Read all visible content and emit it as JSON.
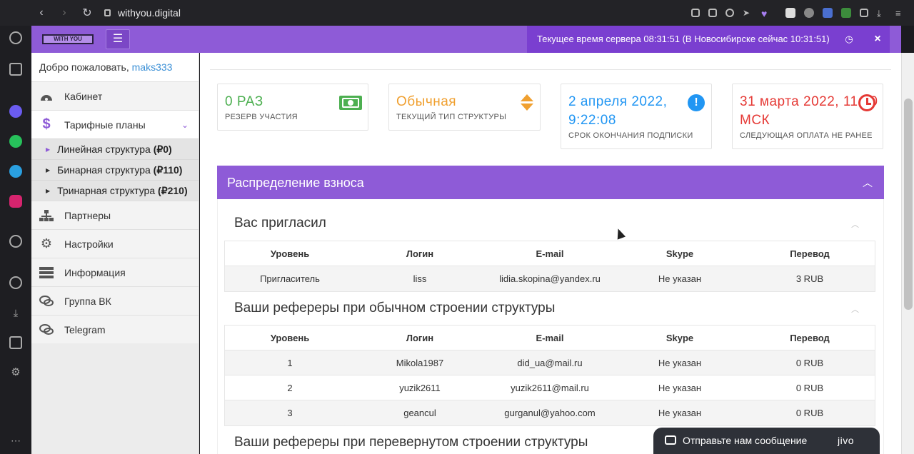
{
  "browser": {
    "url": "withyou.digital"
  },
  "topbar": {
    "logo_text": "WITH YOU",
    "server_time": "Текущее время сервера 08:31:51 (В Новосибирске сейчас 10:31:51)"
  },
  "sidebar": {
    "welcome_prefix": "Добро пожаловать,",
    "username": "maks333",
    "items": [
      {
        "label": "Кабинет"
      },
      {
        "label": "Тарифные планы"
      },
      {
        "label": "Партнеры"
      },
      {
        "label": "Настройки"
      },
      {
        "label": "Информация"
      },
      {
        "label": "Группа ВК"
      },
      {
        "label": "Telegram"
      }
    ],
    "subitems": [
      {
        "label": "Линейная структура ",
        "price": "(₽0)"
      },
      {
        "label": "Бинарная структура ",
        "price": "(₽110)"
      },
      {
        "label": "Тринарная структура ",
        "price": "(₽210)"
      }
    ]
  },
  "cards": [
    {
      "value": "0 РАЗ",
      "label": "РЕЗЕРВ УЧАСТИЯ",
      "color": "#4caf50"
    },
    {
      "value": "Обычная",
      "label": "ТЕКУЩИЙ ТИП СТРУКТУРЫ",
      "color": "#f0a030"
    },
    {
      "value_line1": "2 апреля 2022,",
      "value_line2": "9:22:08",
      "label": "СРОК ОКОНЧАНИЯ ПОДПИСКИ",
      "color": "#2196f3"
    },
    {
      "value_line1": "31 марта 2022, 11:00",
      "value_line2": "МСК",
      "label": "СЛЕДУЮЩАЯ ОПЛАТА НЕ РАНЕЕ",
      "color": "#e53935"
    }
  ],
  "panel": {
    "title": "Распределение взноса"
  },
  "sections": [
    {
      "title": "Вас пригласил",
      "headers": [
        "Уровень",
        "Логин",
        "E-mail",
        "Skype",
        "Перевод"
      ],
      "rows": [
        [
          "Пригласитель",
          "liss",
          "lidia.skopina@yandex.ru",
          "Не указан",
          "3 RUB"
        ]
      ]
    },
    {
      "title": "Ваши рефереры при обычном строении структуры",
      "headers": [
        "Уровень",
        "Логин",
        "E-mail",
        "Skype",
        "Перевод"
      ],
      "rows": [
        [
          "1",
          "Mikola1987",
          "did_ua@mail.ru",
          "Не указан",
          "0 RUB"
        ],
        [
          "2",
          "yuzik2611",
          "yuzik2611@mail.ru",
          "Не указан",
          "0 RUB"
        ],
        [
          "3",
          "geancul",
          "gurganul@yahoo.com",
          "Не указан",
          "0 RUB"
        ]
      ]
    },
    {
      "title": "Ваши рефереры при перевернутом строении структуры"
    }
  ],
  "chat": {
    "text": "Отправьте нам сообщение",
    "brand": "jivo"
  },
  "colors": {
    "accent": "#8e5bd7",
    "accent_dark": "#7a3fd0"
  }
}
